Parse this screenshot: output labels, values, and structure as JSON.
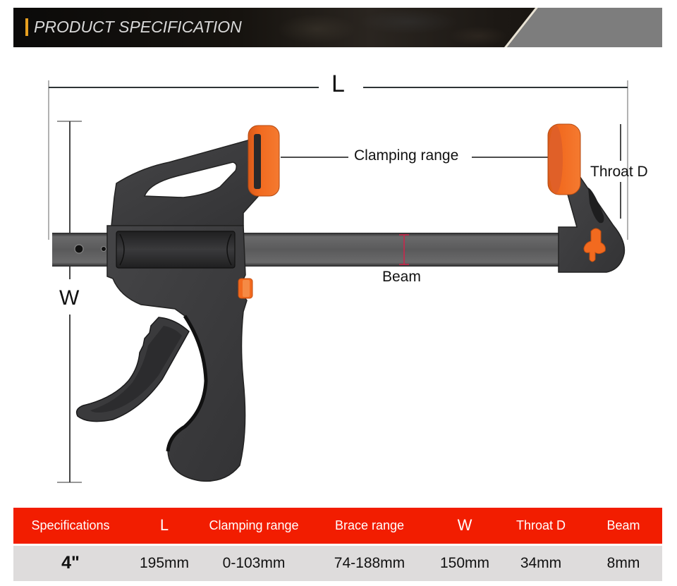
{
  "header": {
    "title": "PRODUCT SPECIFICATION",
    "accent_color": "#e8a020"
  },
  "diagram": {
    "subject": "quick-release bar clamp (one-hand clamp)",
    "labels": {
      "length": "L",
      "width": "W",
      "clamping_range": "Clamping range",
      "throat_depth": "Throat D",
      "beam": "Beam"
    },
    "colors": {
      "body": "#3c3c3e",
      "body_dark": "#262627",
      "pad": "#f26a1f",
      "pad_light": "#f58a45",
      "beam": "#5c5c5e",
      "beam_marker": "#d0234a"
    }
  },
  "spec_table": {
    "header_color": "#f21d00",
    "columns": [
      "Specifications",
      "L",
      "Clamping range",
      "Brace range",
      "W",
      "Throat D",
      "Beam"
    ],
    "rows": [
      [
        "4\"",
        "195mm",
        "0-103mm",
        "74-188mm",
        "150mm",
        "34mm",
        "8mm"
      ]
    ]
  }
}
